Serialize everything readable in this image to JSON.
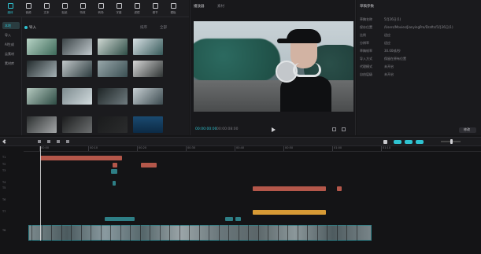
{
  "toolbar": {
    "tools": [
      {
        "label": "媒体",
        "icon": "media-icon",
        "active": true
      },
      {
        "label": "音频",
        "icon": "audio-icon"
      },
      {
        "label": "文本",
        "icon": "text-icon"
      },
      {
        "label": "贴纸",
        "icon": "sticker-icon"
      },
      {
        "label": "特效",
        "icon": "effects-icon"
      },
      {
        "label": "转场",
        "icon": "transition-icon"
      },
      {
        "label": "字幕",
        "icon": "caption-icon"
      },
      {
        "label": "滤镜",
        "icon": "filter-icon"
      },
      {
        "label": "调节",
        "icon": "adjust-icon"
      },
      {
        "label": "模板",
        "icon": "template-icon"
      }
    ]
  },
  "sidebar": {
    "items": [
      {
        "label": "本地",
        "active": true
      },
      {
        "label": "导入"
      },
      {
        "label": "AI生成"
      },
      {
        "label": "云素材"
      },
      {
        "label": "素材库"
      }
    ]
  },
  "media": {
    "import_label": "导入",
    "sort_label": "排序",
    "filter_label": "全部"
  },
  "player": {
    "title": "播放器",
    "tab": "素材",
    "current_time": "00:00:00:00",
    "total_time": "00:00:08:00"
  },
  "details": {
    "title": "草稿参数",
    "rows": [
      {
        "k": "草稿名称",
        "v": "5月26日(1)"
      },
      {
        "k": "保存位置",
        "v": "/Users/Movies/JianyingPro/Drafts/5月26日(1)"
      },
      {
        "k": "比例",
        "v": "适应"
      },
      {
        "k": "分辨率",
        "v": "适应"
      },
      {
        "k": "草稿帧率",
        "v": "30.00帧/秒"
      },
      {
        "k": "导入方式",
        "v": "保留在原有位置"
      },
      {
        "k": "代理模式",
        "v": "未开启"
      },
      {
        "k": "自由层级",
        "v": "未开启"
      }
    ],
    "modify_button": "修改"
  },
  "timeline": {
    "ticks": [
      "00:00",
      "00:10",
      "00:20",
      "00:30",
      "00:40",
      "00:50",
      "01:00",
      "01:10"
    ],
    "tracks": [
      "T1",
      "T2",
      "T3",
      "T4",
      "T5",
      "T6",
      "T7",
      "T8"
    ]
  }
}
